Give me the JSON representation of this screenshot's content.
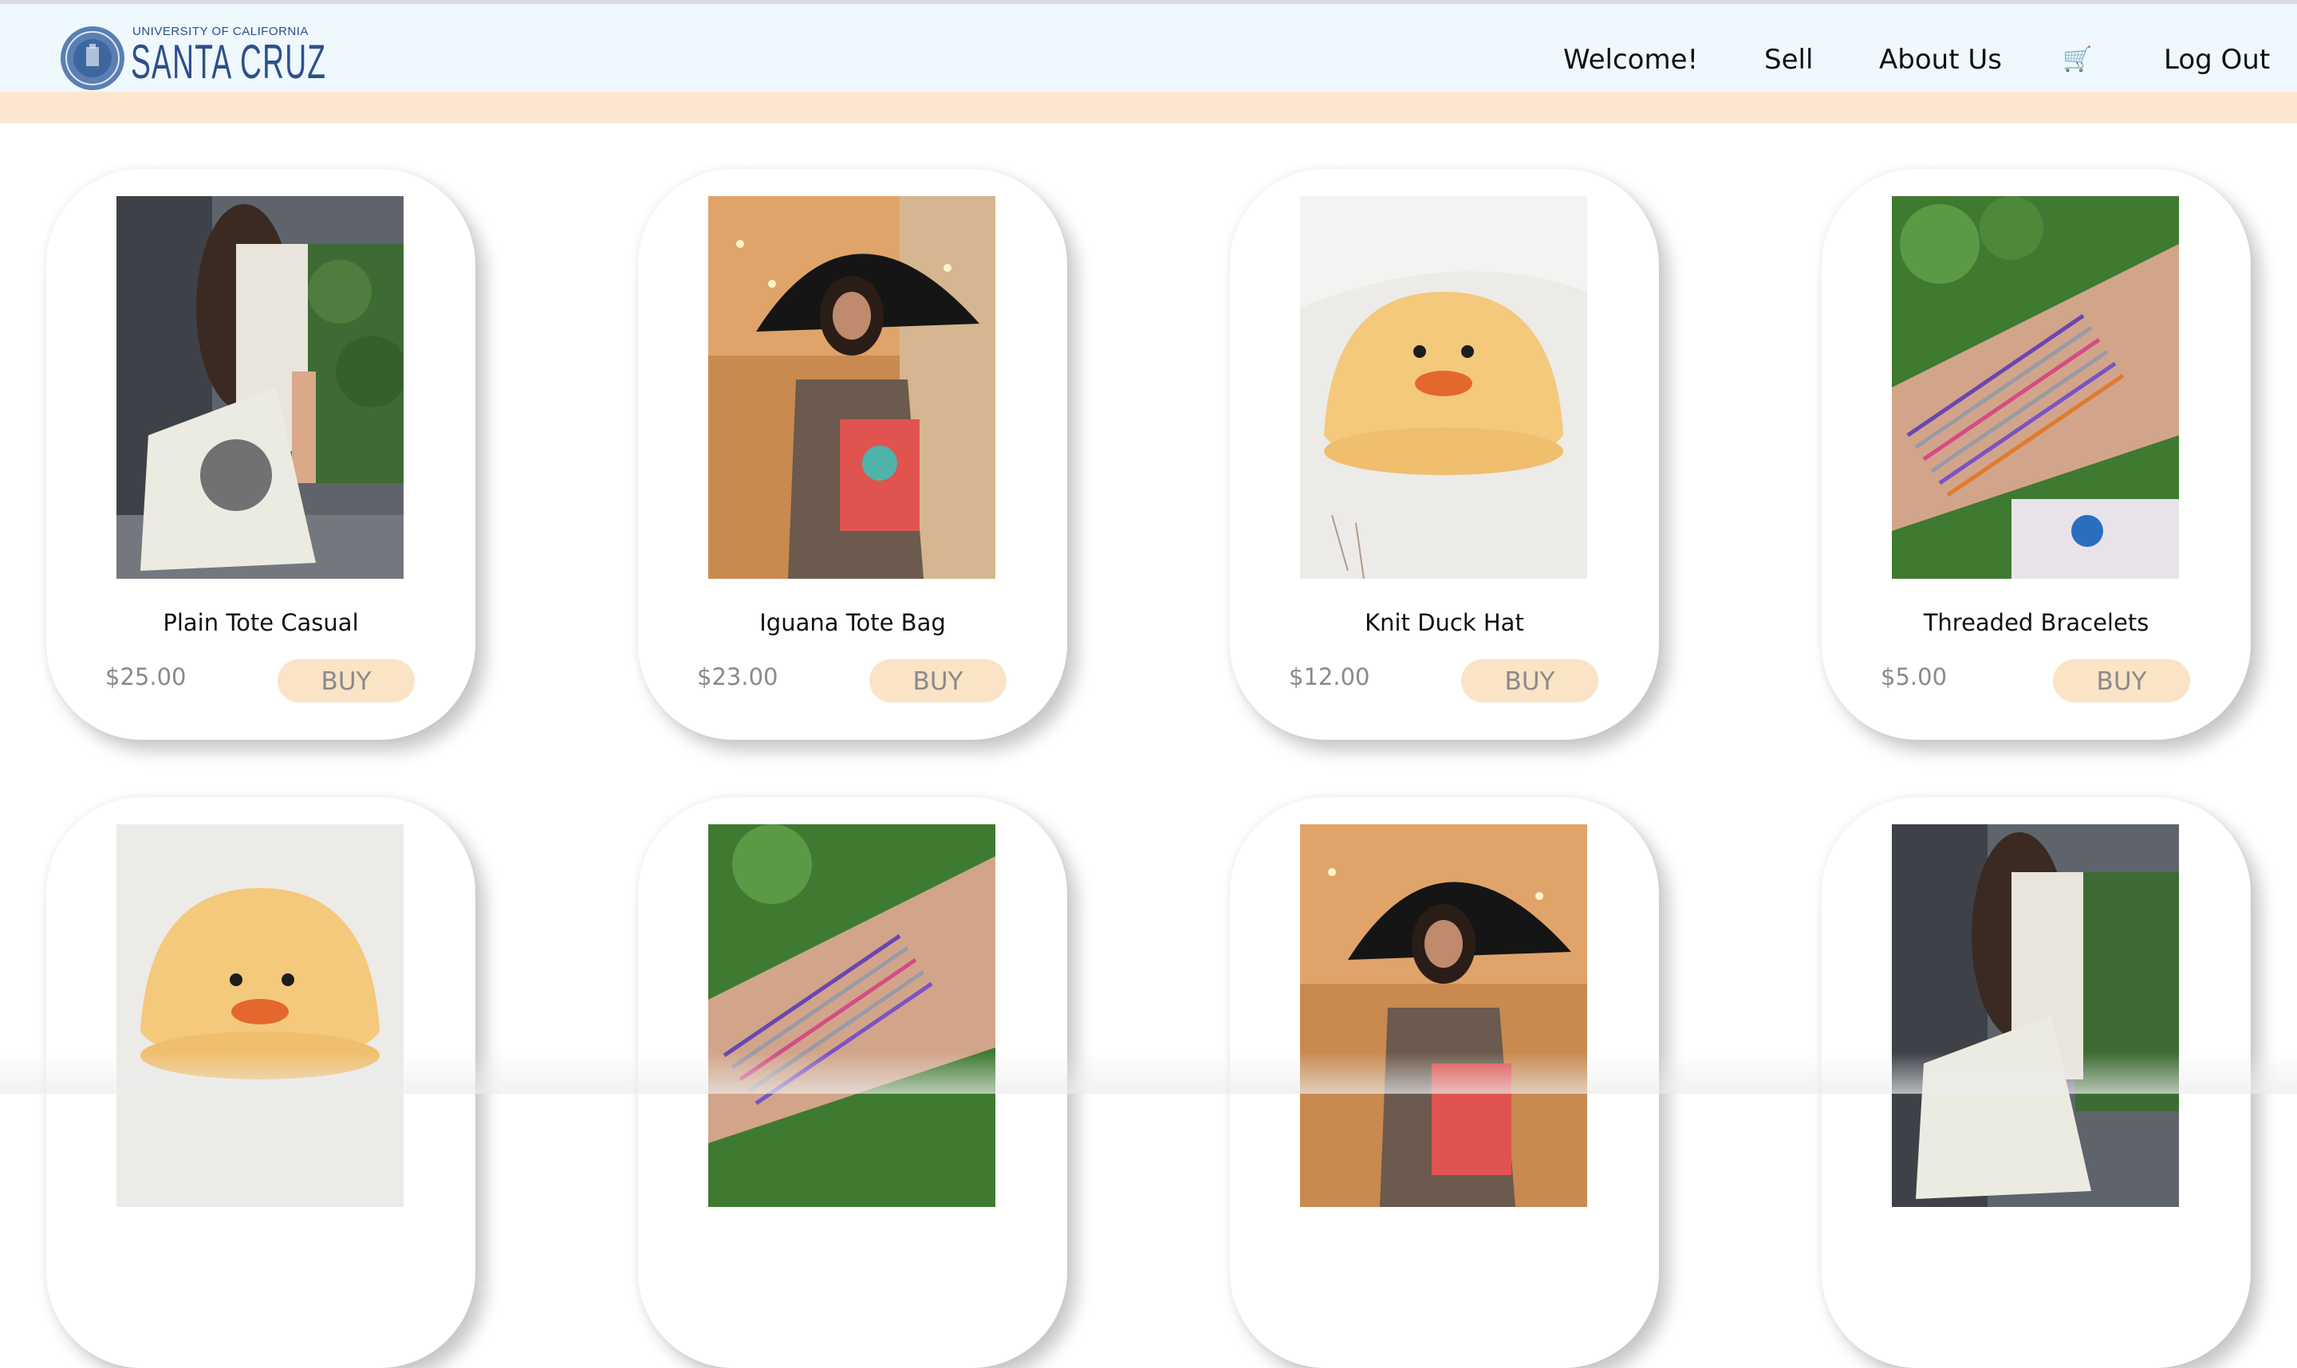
{
  "header": {
    "logo_small": "UNIVERSITY OF CALIFORNIA",
    "logo_big": "SANTA CRUZ",
    "nav": {
      "welcome": "Welcome!",
      "sell": "Sell",
      "about": "About Us",
      "cart_icon": "🛒",
      "logout": "Log Out"
    }
  },
  "colors": {
    "navbar_bg": "#eef8fd",
    "subbar_bg": "#fbe7cf",
    "buy_bg": "#fbe3c6",
    "brand_blue": "#2e4f8a"
  },
  "buy_label": "BUY",
  "products": [
    {
      "name": "Plain Tote Casual",
      "price": "$25.00",
      "image": "woman-with-tote-bag-photo"
    },
    {
      "name": "Iguana Tote Bag",
      "price": "$23.00",
      "image": "woman-with-umbrella-and-tote-photo"
    },
    {
      "name": "Knit Duck Hat",
      "price": "$12.00",
      "image": "knit-duck-hat-photo"
    },
    {
      "name": "Threaded Bracelets",
      "price": "$5.00",
      "image": "bracelets-on-wrist-photo"
    },
    {
      "image": "knit-duck-hat-photo"
    },
    {
      "image": "bracelets-on-wrist-photo"
    },
    {
      "image": "woman-with-umbrella-and-tote-photo"
    },
    {
      "image": "woman-with-tote-bag-photo"
    }
  ]
}
